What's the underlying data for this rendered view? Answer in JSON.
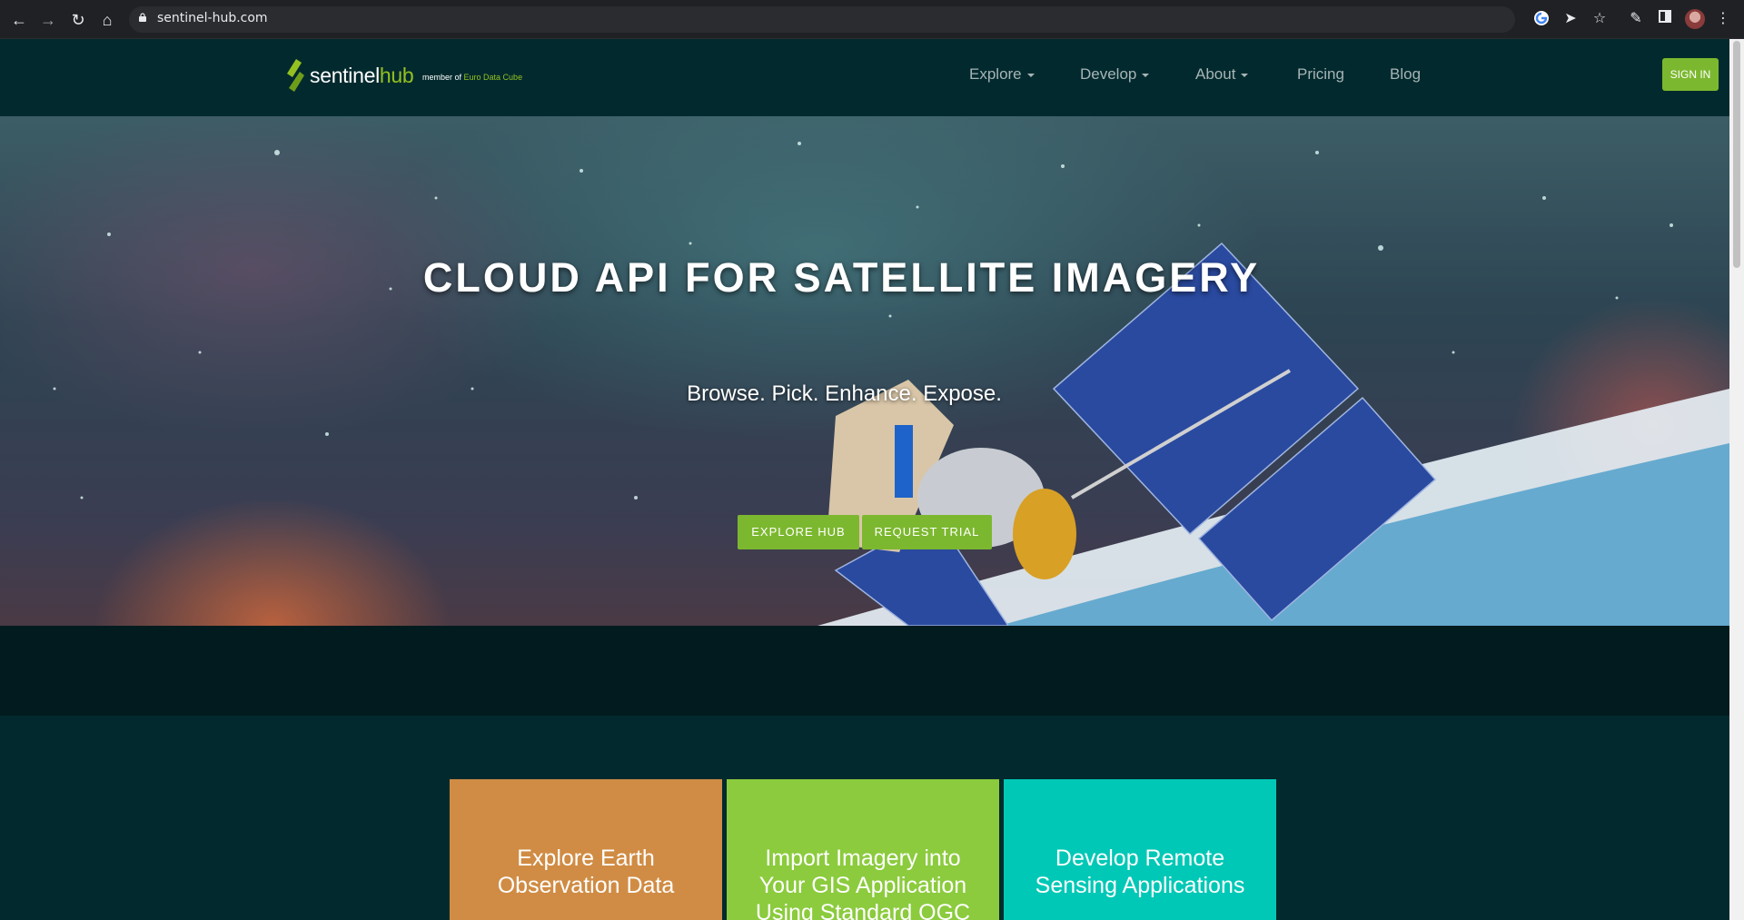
{
  "browser": {
    "url": "sentinel-hub.com",
    "icons": [
      "back-icon",
      "forward-icon",
      "reload-icon",
      "home-icon",
      "lock-icon",
      "google-icon",
      "share-icon",
      "star-icon",
      "extensions-icon",
      "sidebar-icon",
      "avatar",
      "menu-dots-icon"
    ]
  },
  "site": {
    "logo": {
      "word_prefix": "sentinel",
      "word_suffix": "hub"
    },
    "member_prefix": "member of",
    "member_link": "Euro Data Cube",
    "nav": [
      {
        "label": "Explore",
        "dropdown": true
      },
      {
        "label": "Develop",
        "dropdown": true
      },
      {
        "label": "About",
        "dropdown": true
      },
      {
        "label": "Pricing",
        "dropdown": false
      },
      {
        "label": "Blog",
        "dropdown": false
      }
    ],
    "signin_label": "SIGN IN"
  },
  "hero": {
    "title": "CLOUD API FOR SATELLITE IMAGERY",
    "tagline": "Browse. Pick. Enhance. Expose.",
    "primary_button": "EXPLORE HUB",
    "secondary_button": "REQUEST TRIAL"
  },
  "cards": [
    {
      "text": "Explore Earth Observation Data",
      "color": "#d08c44"
    },
    {
      "text": "Import Imagery into Your GIS Application Using Standard OGC",
      "color": "#8bcb3d"
    },
    {
      "text": "Develop Remote Sensing Applications",
      "color": "#00c8b6"
    }
  ],
  "colors": {
    "accent": "#7cb82f",
    "background": "#022a2e",
    "band": "#011b1e"
  }
}
